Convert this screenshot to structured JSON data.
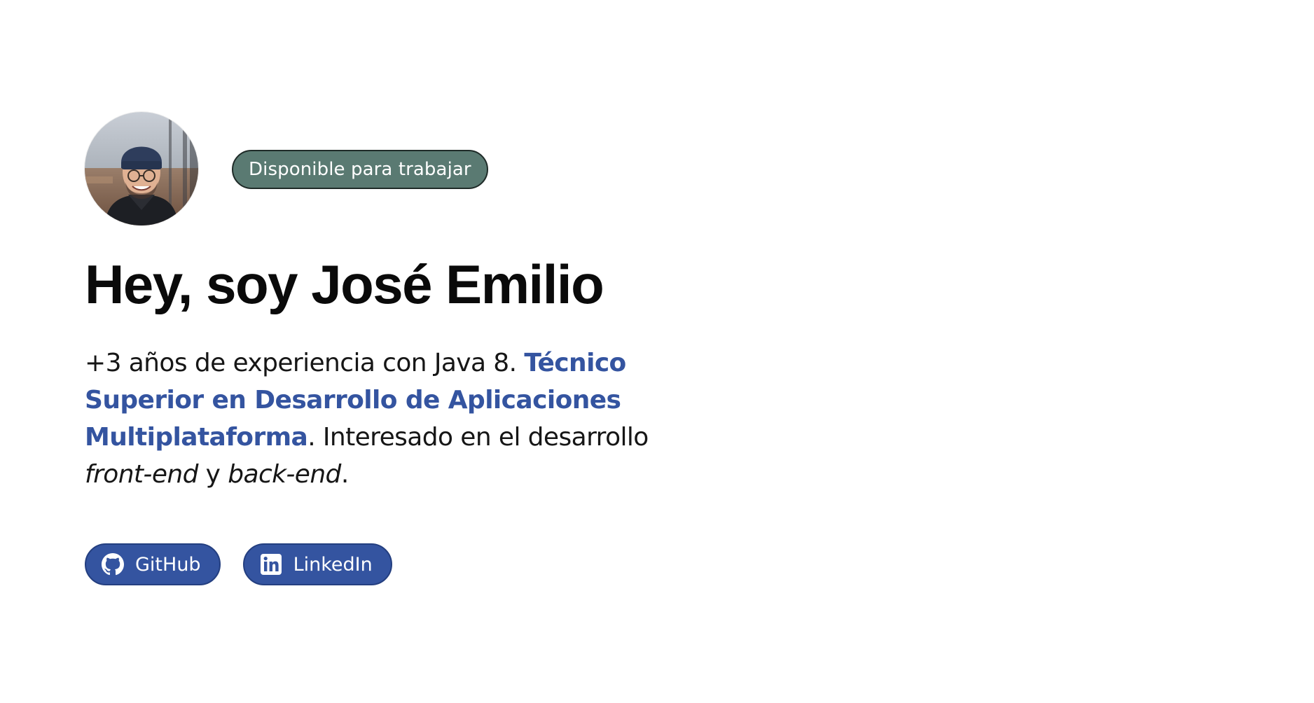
{
  "profile": {
    "avatar_icon": "profile-photo",
    "status_badge": "Disponible para trabajar",
    "title": "Hey, soy José Emilio",
    "description": {
      "intro": "+3 años de experiencia con Java 8. ",
      "highlight": "Técnico Superior en Desarrollo de Aplicaciones Multiplataforma",
      "middle": ". Interesado en el desarrollo ",
      "em1": "front-end",
      "and": " y ",
      "em2": "back-end",
      "end": "."
    }
  },
  "links": [
    {
      "label": "GitHub",
      "icon": "github-icon"
    },
    {
      "label": "LinkedIn",
      "icon": "linkedin-icon"
    }
  ],
  "colors": {
    "badge_bg": "#5a7a72",
    "badge_border": "#1f2b28",
    "accent": "#3454a0",
    "button_bg": "#3454a0",
    "button_border": "#243f80",
    "text": "#111111",
    "background": "#ffffff"
  }
}
